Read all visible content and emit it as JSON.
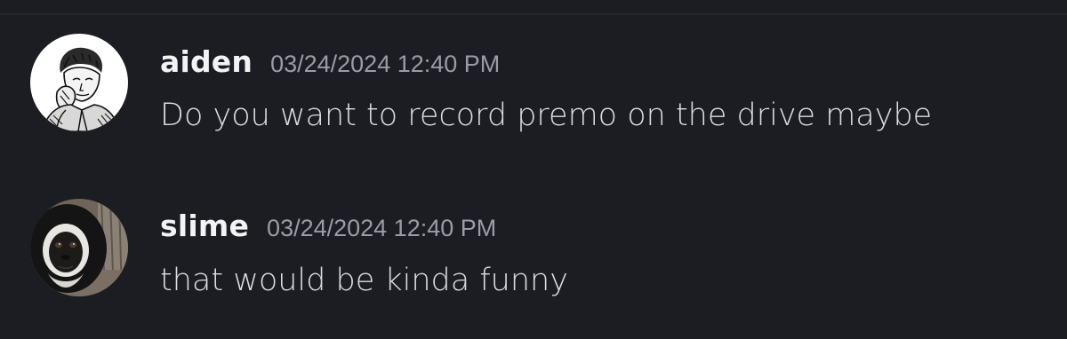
{
  "messages": [
    {
      "username": "aiden",
      "timestamp": "03/24/2024 12:40 PM",
      "content": "Do you want to record premo on the drive maybe",
      "avatar_icon": "sketch-portrait-avatar"
    },
    {
      "username": "slime",
      "timestamp": "03/24/2024 12:40 PM",
      "content": "that would be kinda funny",
      "avatar_icon": "gibbon-photo-avatar"
    }
  ],
  "colors": {
    "background": "#1c1d22",
    "username": "#f2f3f5",
    "timestamp": "#9a9ca6",
    "content": "#dbdde1"
  }
}
